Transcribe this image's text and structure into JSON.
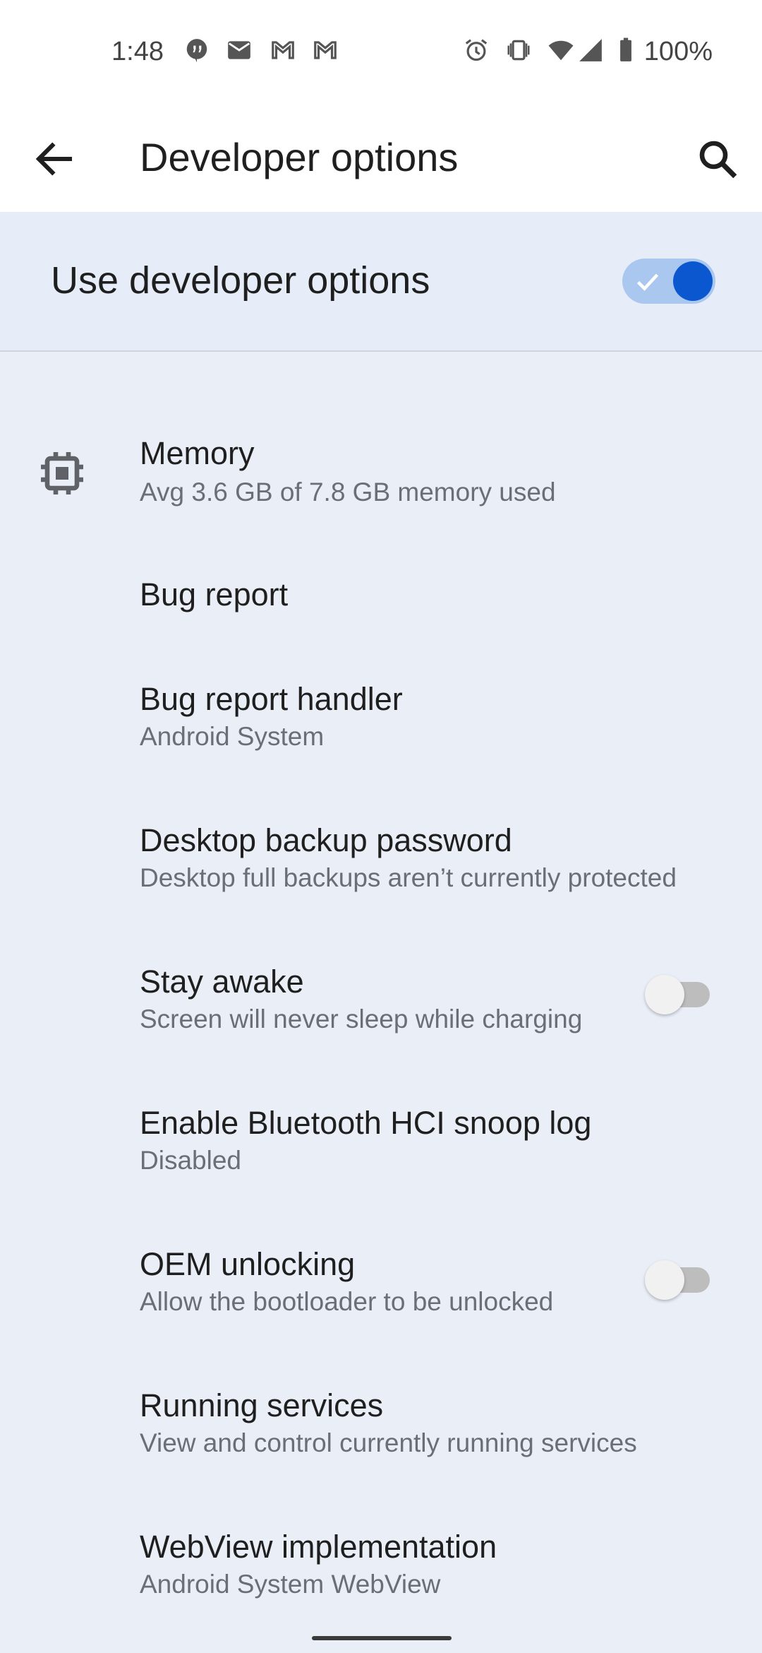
{
  "status_bar": {
    "time": "1:48",
    "battery_text": "100%",
    "left_icons": [
      "chat-icon",
      "mail-icon",
      "gmail-icon",
      "gmail-icon"
    ],
    "right_icons": [
      "alarm-icon",
      "vibrate-icon",
      "wifi-icon",
      "signal-icon",
      "battery-icon"
    ]
  },
  "app_bar": {
    "title": "Developer options"
  },
  "master_switch": {
    "label": "Use developer options",
    "enabled": true
  },
  "items": [
    {
      "title": "Memory",
      "subtitle": "Avg 3.6 GB of 7.8 GB memory used",
      "icon": "memory-chip-icon"
    },
    {
      "title": "Bug report",
      "subtitle": ""
    },
    {
      "title": "Bug report handler",
      "subtitle": "Android System"
    },
    {
      "title": "Desktop backup password",
      "subtitle": "Desktop full backups aren’t currently protected"
    },
    {
      "title": "Stay awake",
      "subtitle": "Screen will never sleep while charging",
      "toggle": false
    },
    {
      "title": "Enable Bluetooth HCI snoop log",
      "subtitle": "Disabled"
    },
    {
      "title": "OEM unlocking",
      "subtitle": "Allow the bootloader to be unlocked",
      "toggle": false
    },
    {
      "title": "Running services",
      "subtitle": "View and control currently running services"
    },
    {
      "title": "WebView implementation",
      "subtitle": "Android System WebView"
    }
  ],
  "colors": {
    "background": "#e9eef7",
    "accent": "#0b57d0",
    "toggle_track_on": "#a9c7ef"
  }
}
